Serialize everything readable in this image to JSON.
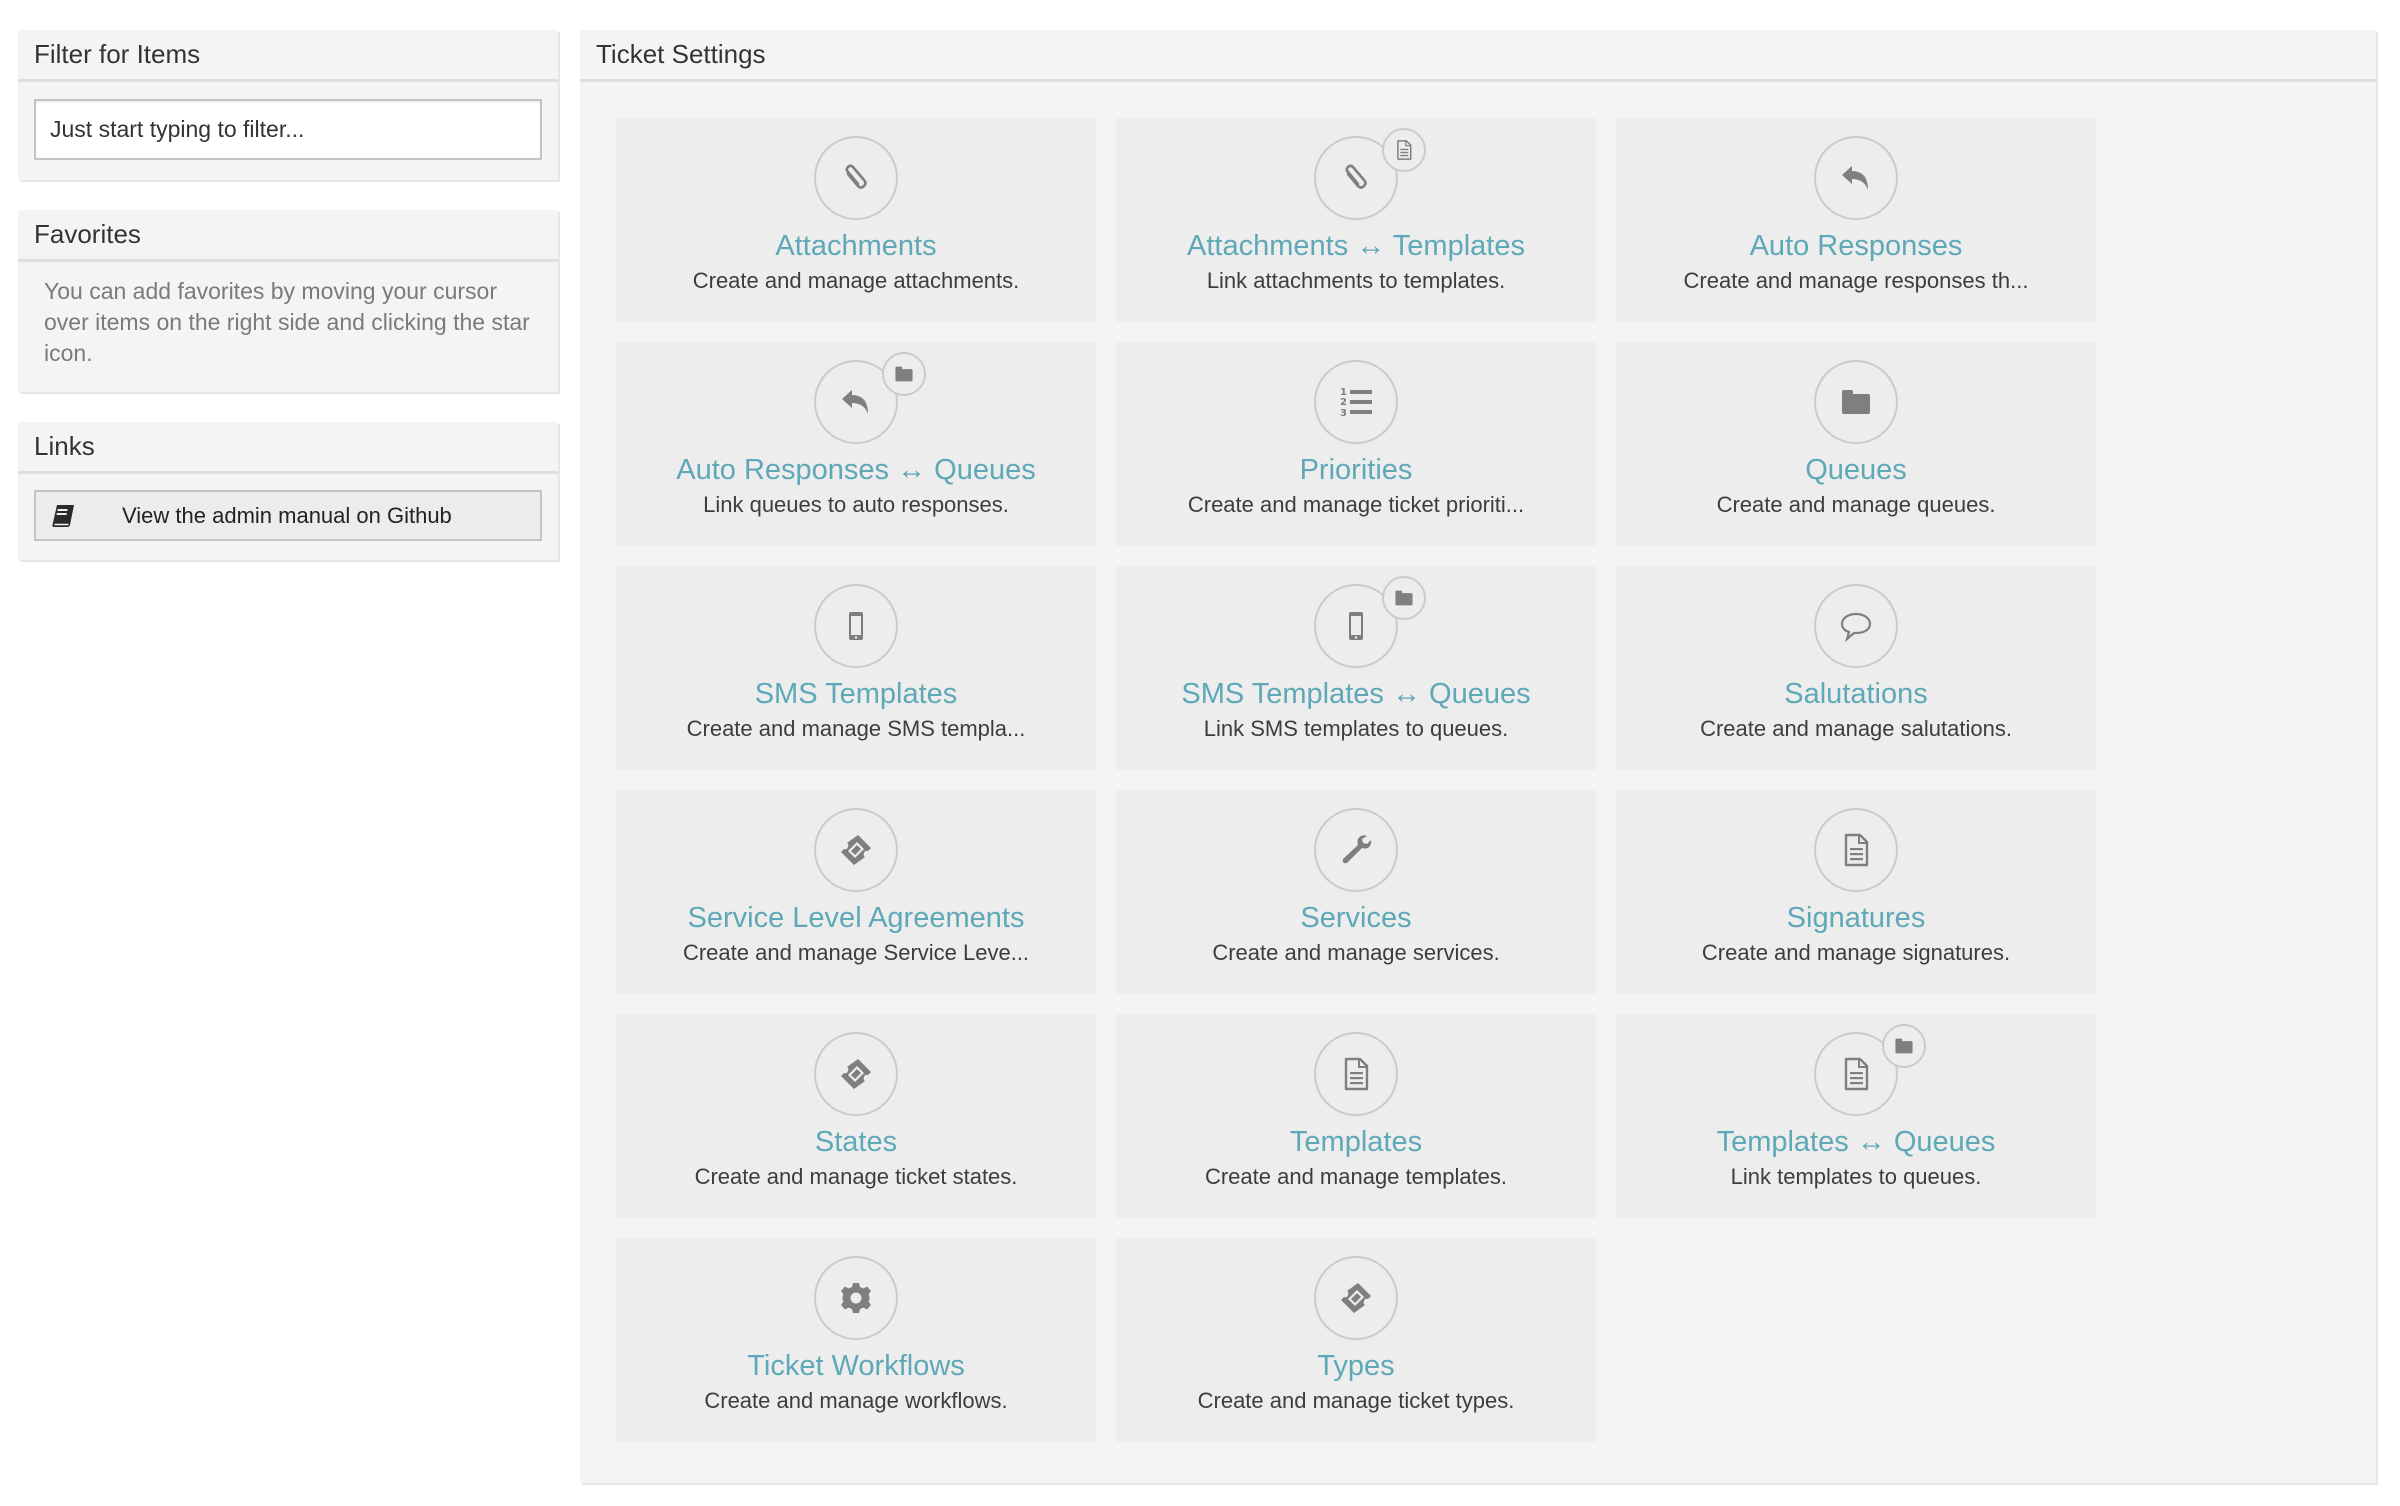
{
  "sidebar": {
    "filter": {
      "title": "Filter for Items",
      "placeholder": "Just start typing to filter..."
    },
    "favorites": {
      "title": "Favorites",
      "text": "You can add favorites by moving your cursor over items on the right side and clicking the star icon."
    },
    "links": {
      "title": "Links",
      "items": [
        {
          "label": "View the admin manual on Github",
          "icon": "book-icon"
        }
      ]
    }
  },
  "main": {
    "title": "Ticket Settings",
    "items": [
      {
        "title": "Attachments",
        "description": "Create and manage attachments.",
        "icon": "paperclip-icon",
        "badge": null
      },
      {
        "title": "Attachments ↔ Templates",
        "description": "Link attachments to templates.",
        "icon": "paperclip-icon",
        "badge": "document-icon"
      },
      {
        "title": "Auto Responses",
        "description": "Create and manage responses th...",
        "icon": "reply-icon",
        "badge": null
      },
      {
        "title": "Auto Responses ↔ Queues",
        "description": "Link queues to auto responses.",
        "icon": "reply-icon",
        "badge": "folder-icon"
      },
      {
        "title": "Priorities",
        "description": "Create and manage ticket prioriti...",
        "icon": "ordered-list-icon",
        "badge": null
      },
      {
        "title": "Queues",
        "description": "Create and manage queues.",
        "icon": "folder-icon",
        "badge": null
      },
      {
        "title": "SMS Templates",
        "description": "Create and manage SMS templa...",
        "icon": "mobile-icon",
        "badge": null
      },
      {
        "title": "SMS Templates ↔ Queues",
        "description": "Link SMS templates to queues.",
        "icon": "mobile-icon",
        "badge": "folder-icon"
      },
      {
        "title": "Salutations",
        "description": "Create and manage salutations.",
        "icon": "speech-bubble-icon",
        "badge": null
      },
      {
        "title": "Service Level Agreements",
        "description": "Create and manage Service Leve...",
        "icon": "ticket-icon",
        "badge": null
      },
      {
        "title": "Services",
        "description": "Create and manage services.",
        "icon": "wrench-icon",
        "badge": null
      },
      {
        "title": "Signatures",
        "description": "Create and manage signatures.",
        "icon": "document-icon",
        "badge": null
      },
      {
        "title": "States",
        "description": "Create and manage ticket states.",
        "icon": "ticket-icon",
        "badge": null
      },
      {
        "title": "Templates",
        "description": "Create and manage templates.",
        "icon": "document-icon",
        "badge": null
      },
      {
        "title": "Templates ↔ Queues",
        "description": "Link templates to queues.",
        "icon": "document-icon",
        "badge": "folder-icon"
      },
      {
        "title": "Ticket Workflows",
        "description": "Create and manage workflows.",
        "icon": "gear-icon",
        "badge": null
      },
      {
        "title": "Types",
        "description": "Create and manage ticket types.",
        "icon": "ticket-icon",
        "badge": null
      }
    ]
  },
  "colors": {
    "accent": "#5ea8b7",
    "panel_bg": "#f4f4f4",
    "tile_bg": "#ededed",
    "icon": "#7f7f7f"
  }
}
